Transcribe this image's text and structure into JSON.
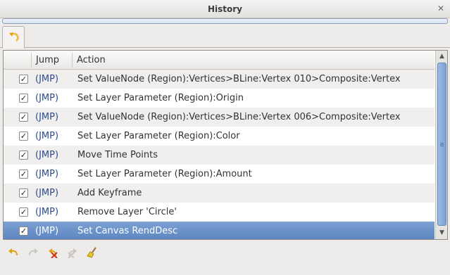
{
  "window": {
    "title": "History",
    "close_glyph": "✕"
  },
  "tabs": [
    {
      "icon": "history-undo-icon"
    }
  ],
  "table": {
    "headers": {
      "check": "",
      "jump": "Jump",
      "action": "Action"
    },
    "rows": [
      {
        "checked": true,
        "jump": "(JMP)",
        "action": "Set ValueNode (Region):Vertices>BLine:Vertex 010>Composite:Vertex"
      },
      {
        "checked": true,
        "jump": "(JMP)",
        "action": "Set Layer Parameter (Region):Origin"
      },
      {
        "checked": true,
        "jump": "(JMP)",
        "action": "Set ValueNode (Region):Vertices>BLine:Vertex 006>Composite:Vertex"
      },
      {
        "checked": true,
        "jump": "(JMP)",
        "action": "Set Layer Parameter (Region):Color"
      },
      {
        "checked": true,
        "jump": "(JMP)",
        "action": "Move Time Points"
      },
      {
        "checked": true,
        "jump": "(JMP)",
        "action": "Set Layer Parameter (Region):Amount"
      },
      {
        "checked": true,
        "jump": "(JMP)",
        "action": "Add Keyframe"
      },
      {
        "checked": true,
        "jump": "(JMP)",
        "action": "Remove Layer 'Circle'"
      },
      {
        "checked": true,
        "jump": "(JMP)",
        "action": "Set Canvas RendDesc",
        "selected": true
      }
    ]
  },
  "toolbar": {
    "buttons": [
      {
        "name": "undo-button",
        "icon": "undo-icon",
        "enabled": true
      },
      {
        "name": "redo-button",
        "icon": "redo-icon",
        "enabled": false
      },
      {
        "name": "clear-undo-button",
        "icon": "clear-undo-icon",
        "enabled": true
      },
      {
        "name": "clear-redo-button",
        "icon": "clear-redo-icon",
        "enabled": false
      },
      {
        "name": "clear-history-button",
        "icon": "broom-icon",
        "enabled": true
      }
    ]
  },
  "colors": {
    "selection": "#5b84c0",
    "jump_link": "#2b4b8c",
    "scroll_thumb": "#7ba1d4"
  }
}
